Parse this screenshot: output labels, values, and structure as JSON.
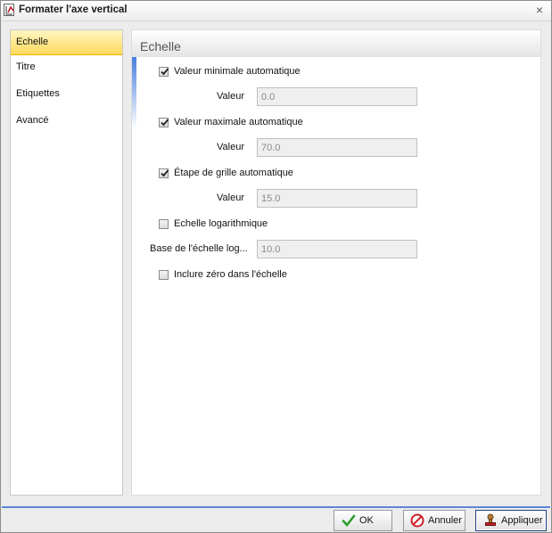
{
  "window": {
    "title": "Formater l'axe vertical",
    "close_glyph": "×"
  },
  "sidebar": {
    "items": [
      {
        "label": "Echelle",
        "selected": true
      },
      {
        "label": "Titre",
        "selected": false
      },
      {
        "label": "Etiquettes",
        "selected": false
      },
      {
        "label": "Avancé",
        "selected": false
      }
    ]
  },
  "panel": {
    "title": "Echelle",
    "min_auto": {
      "label": "Valeur minimale automatique",
      "checked": true
    },
    "min_value": {
      "label": "Valeur",
      "value": "0.0"
    },
    "max_auto": {
      "label": "Valeur maximale automatique",
      "checked": true
    },
    "max_value": {
      "label": "Valeur",
      "value": "70.0"
    },
    "step_auto": {
      "label": "Étape de grille automatique",
      "checked": true
    },
    "step_value": {
      "label": "Valeur",
      "value": "15.0"
    },
    "log_scale": {
      "label": "Echelle logarithmique",
      "checked": false
    },
    "log_base": {
      "label": "Base de l'échelle log...",
      "value": "10.0"
    },
    "include_zero": {
      "label": "Inclure zéro dans l'échelle",
      "checked": false
    }
  },
  "footer": {
    "ok_label": "OK",
    "cancel_label": "Annuler",
    "apply_label": "Appliquer"
  },
  "colors": {
    "accent": "#4a7ee0",
    "selected_item": "#ffd95a",
    "footer_line": "#5b87d6"
  },
  "icons": {
    "title": "chart-axis-icon",
    "ok": "checkmark-icon",
    "cancel": "no-entry-icon",
    "apply": "stamp-icon"
  }
}
